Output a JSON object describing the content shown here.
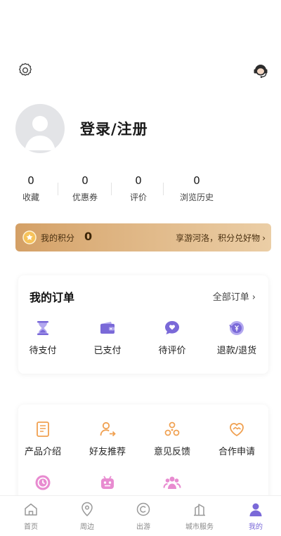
{
  "header": {
    "settings_icon": "gear-icon",
    "service_icon": "headset-icon"
  },
  "profile": {
    "avatar_icon": "default-avatar-icon",
    "login_text": "登录/注册"
  },
  "stats": [
    {
      "value": "0",
      "label": "收藏"
    },
    {
      "value": "0",
      "label": "优惠券"
    },
    {
      "value": "0",
      "label": "评价"
    },
    {
      "value": "0",
      "label": "浏览历史"
    }
  ],
  "points": {
    "icon": "star-coin-icon",
    "label": "我的积分",
    "value": "0",
    "link_text": "享游河洛，积分兑好物",
    "chevron": "›"
  },
  "orders": {
    "title": "我的订单",
    "all_link": "全部订单",
    "chevron": "›",
    "items": [
      {
        "label": "待支付",
        "icon": "hourglass-icon"
      },
      {
        "label": "已支付",
        "icon": "wallet-icon"
      },
      {
        "label": "待评价",
        "icon": "chat-heart-icon"
      },
      {
        "label": "退款/退货",
        "icon": "refund-icon"
      }
    ]
  },
  "tools": {
    "items": [
      {
        "label": "产品介绍",
        "icon": "document-icon"
      },
      {
        "label": "好友推荐",
        "icon": "user-share-icon"
      },
      {
        "label": "意见反馈",
        "icon": "feedback-icon"
      },
      {
        "label": "合作申请",
        "icon": "handshake-icon"
      }
    ],
    "row2_icons": [
      "clock-icon",
      "robot-icon",
      "group-icon"
    ]
  },
  "tabbar": {
    "tabs": [
      {
        "label": "首页",
        "icon": "home-icon",
        "active": false
      },
      {
        "label": "周边",
        "icon": "location-pin-icon",
        "active": false
      },
      {
        "label": "出游",
        "icon": "travel-icon",
        "active": false
      },
      {
        "label": "城市服务",
        "icon": "city-icon",
        "active": false
      },
      {
        "label": "我的",
        "icon": "person-icon",
        "active": true
      }
    ]
  },
  "colors": {
    "accent": "#7a69d8",
    "gold": "#d4a066",
    "orange": "#f0a050"
  }
}
